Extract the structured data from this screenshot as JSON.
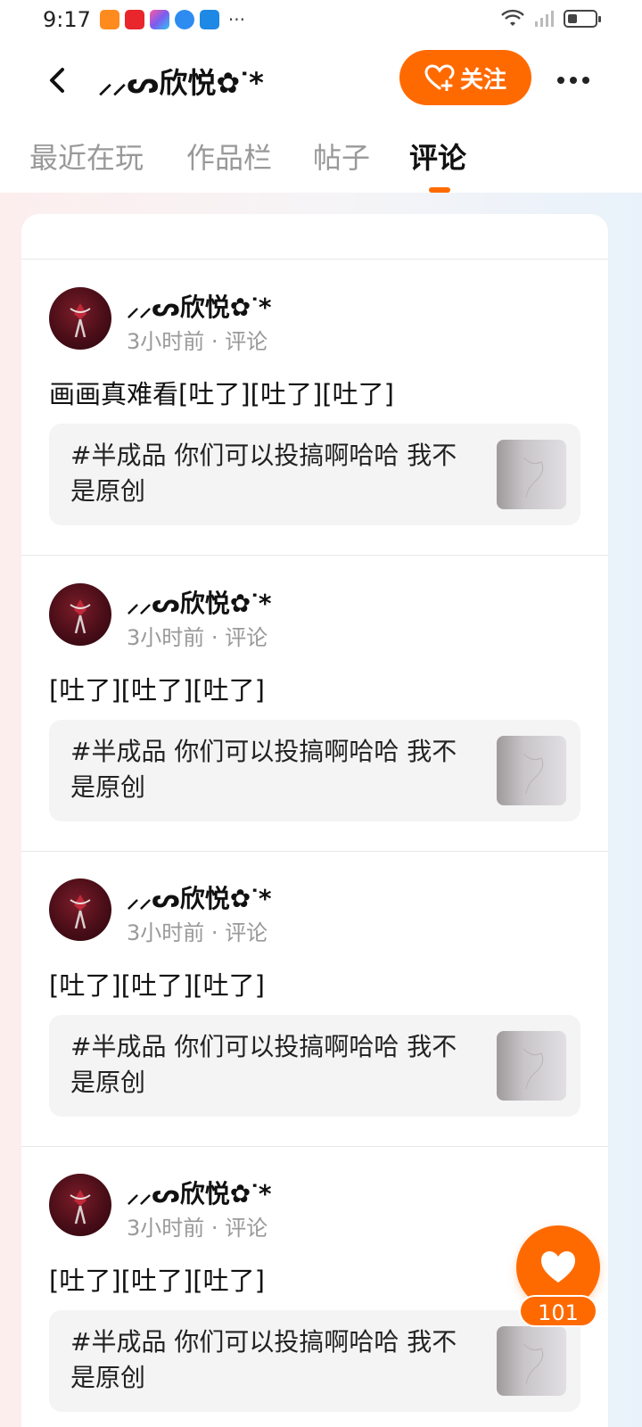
{
  "status_bar": {
    "time": "9:17",
    "more": "···",
    "apps": [
      {
        "icon": "video-app-icon",
        "color": "#ff8a1e"
      },
      {
        "icon": "shopping-app-icon",
        "color": "#e8262b"
      },
      {
        "icon": "store-app-icon",
        "color": "#7b5cf0"
      },
      {
        "icon": "browser-app-icon",
        "color": "#2e8cf0"
      },
      {
        "icon": "weather-app-icon",
        "color": "#1e88e5"
      }
    ]
  },
  "header": {
    "title": "⸝⸝ᔕ欣悦✿ᐝ*",
    "follow_label": "关注"
  },
  "tabs": [
    {
      "label": "最近在玩",
      "active": false
    },
    {
      "label": "作品栏",
      "active": false
    },
    {
      "label": "帖子",
      "active": false
    },
    {
      "label": "评论",
      "active": true
    }
  ],
  "comments": [
    {
      "username": "⸝⸝ᔕ欣悦✿ᐝ*",
      "time": "3小时前",
      "type": "评论",
      "text": "画画真难看[吐了][吐了][吐了]",
      "quote": "#半成品 你们可以投搞啊哈哈 我不是原创"
    },
    {
      "username": "⸝⸝ᔕ欣悦✿ᐝ*",
      "time": "3小时前",
      "type": "评论",
      "text": "[吐了][吐了][吐了]",
      "quote": "#半成品 你们可以投搞啊哈哈 我不是原创"
    },
    {
      "username": "⸝⸝ᔕ欣悦✿ᐝ*",
      "time": "3小时前",
      "type": "评论",
      "text": "[吐了][吐了][吐了]",
      "quote": "#半成品 你们可以投搞啊哈哈 我不是原创"
    },
    {
      "username": "⸝⸝ᔕ欣悦✿ᐝ*",
      "time": "3小时前",
      "type": "评论",
      "text": "[吐了][吐了][吐了]",
      "quote": "#半成品 你们可以投搞啊哈哈 我不是原创"
    }
  ],
  "like": {
    "count": "101"
  },
  "colors": {
    "accent": "#ff6a00",
    "muted_text": "#999999"
  }
}
